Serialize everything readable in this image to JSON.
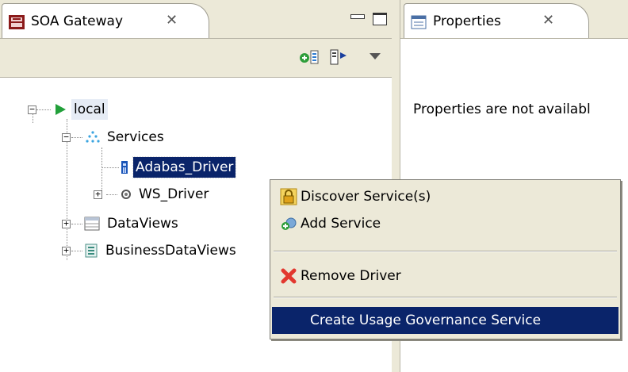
{
  "left_view": {
    "title": "SOA Gateway",
    "close_glyph": "✕",
    "buttons": [
      "minimize-icon",
      "maximize-icon"
    ],
    "toolbar": [
      "add-service-icon",
      "run-icon",
      "view-menu-icon"
    ],
    "tree": {
      "root": "local",
      "services": "Services",
      "adabas_driver": "Adabas_Driver",
      "ws_driver": "WS_Driver",
      "dataviews": "DataViews",
      "businessdataviews": "BusinessDataViews"
    }
  },
  "right_view": {
    "title": "Properties",
    "close_glyph": "✕",
    "message": "Properties are not availabl"
  },
  "context_menu": {
    "items": [
      {
        "label": "Discover Service(s)",
        "icon": "lock-icon"
      },
      {
        "label": "Add Service",
        "icon": "add-service-icon"
      },
      {
        "label": "Remove Driver",
        "icon": "red-x-icon"
      },
      {
        "label": "Create Usage Governance Service",
        "icon": ""
      }
    ],
    "highlighted_index": 3
  },
  "colors": {
    "selection": "#0a246a",
    "chrome": "#ece9d8",
    "run_green": "#22a03a",
    "remove_red": "#e2382f"
  }
}
